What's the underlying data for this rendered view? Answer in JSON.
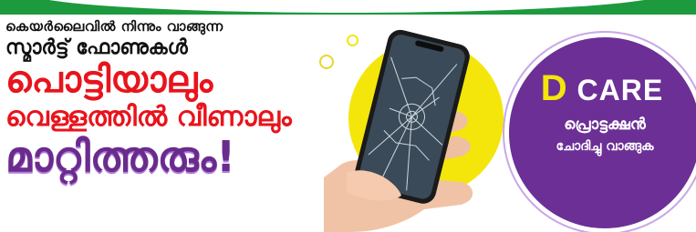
{
  "headline": {
    "line1": "കെയർലൈവിൽ നിന്നും വാങ്ങുന്ന",
    "line2": "സ്മാർട്ട് ഫോണുകൾ",
    "line3": "പൊട്ടിയാലും",
    "line4": "വെള്ളത്തിൽ വീണാലും",
    "line5": "മാറ്റിത്തരും!"
  },
  "badge": {
    "logo_d": "D",
    "logo_rest": "CARE",
    "text1": "പ്രൊട്ടക്ഷൻ",
    "text2": "ചോദിച്ചു വാങ്ങുക"
  },
  "colors": {
    "top_strip": "#1e9a3e",
    "headline_red": "#e8141c",
    "headline_purple": "#6a2c8c",
    "badge_purple": "#6c2f96",
    "accent_yellow": "#f4e60a"
  }
}
